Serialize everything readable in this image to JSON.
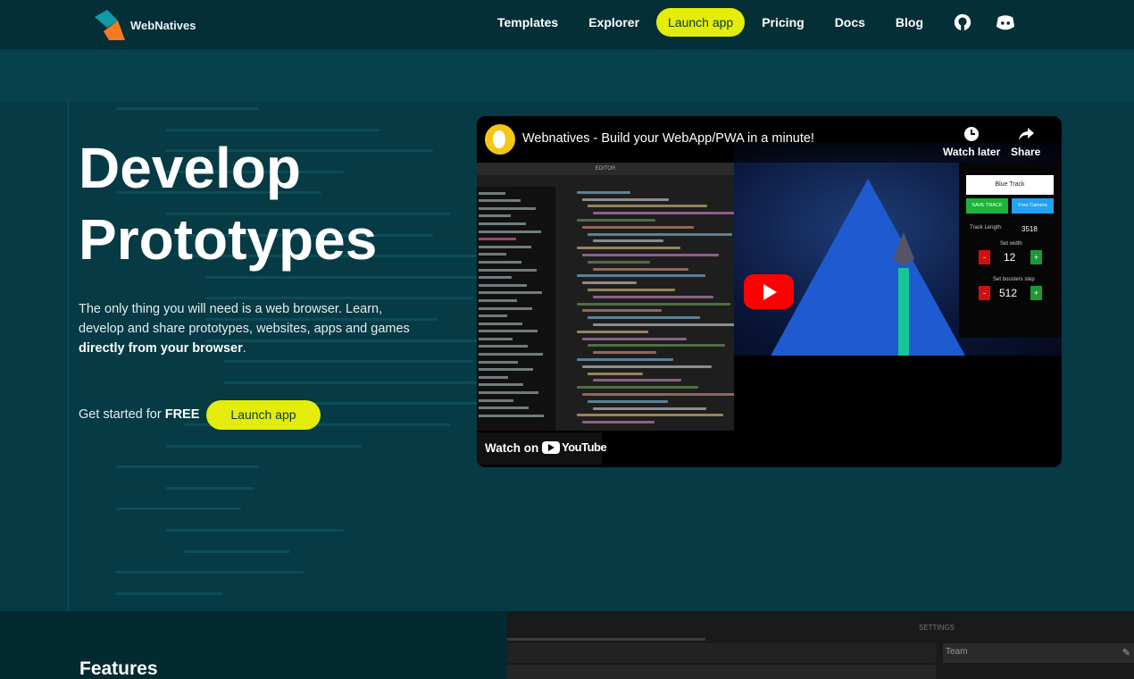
{
  "brand": {
    "name": "WebNatives"
  },
  "nav": {
    "links": [
      "Templates",
      "Explorer",
      "Launch app",
      "Pricing",
      "Docs",
      "Blog"
    ],
    "icons": [
      "github-icon",
      "discord-icon"
    ]
  },
  "code_background": {
    "lines": [
      "  ",
      "  ",
      "  ",
      "  ",
      "  ",
      "  ",
      "  ",
      "  ",
      "  ",
      "  ",
      "  ",
      "  ",
      "  ",
      "  ",
      "  ",
      "  ",
      "  ",
      "  ",
      "  ",
      "  ",
      "  ",
      "  ",
      "  ",
      "  "
    ]
  },
  "hero": {
    "title_line1": "Develop",
    "title_line2": "Prototypes",
    "subtitle_plain": "The only thing you will need is a web browser. Learn, develop and share prototypes, websites, apps and games ",
    "subtitle_bold": "directly from your browser",
    "subtitle_end": ".",
    "getstarted_plain": "Get started for ",
    "getstarted_bold": "FREE",
    "cta_label": "Launch app"
  },
  "video": {
    "title": "Webnatives - Build your WebApp/PWA in a minute!",
    "watch_later": "Watch later",
    "share": "Share",
    "watch_on": "Watch on",
    "youtube": "YouTube",
    "editor_header": "EDITOR",
    "panel": {
      "track_name": "Blue Track",
      "save_track": "SAVE TRACK",
      "free_camera": "Free Camera",
      "track_length_label": "Track Length:",
      "track_length_value": "3518",
      "set_width_label": "Set width",
      "set_width_value": "12",
      "boosters_label": "Set boosters step",
      "boosters_value": "512"
    }
  },
  "features": {
    "title": "Features",
    "settings_label": "SETTINGS",
    "team_label": "Team"
  }
}
